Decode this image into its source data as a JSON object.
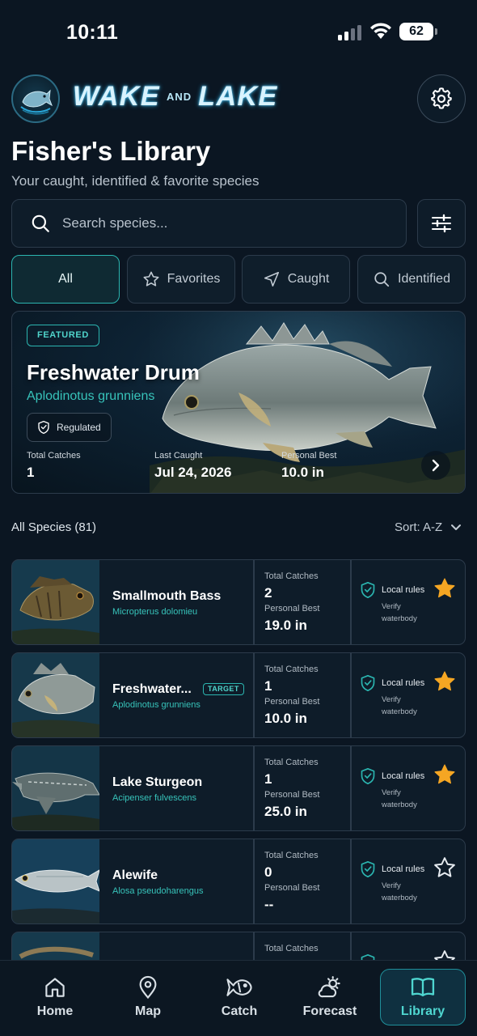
{
  "status_bar": {
    "time": "10:11",
    "battery": "62"
  },
  "brand": {
    "word_left": "WAKE",
    "word_mid": "AND",
    "word_right": "LAKE"
  },
  "header": {
    "title": "Fisher's Library",
    "subtitle": "Your caught, identified & favorite species"
  },
  "search": {
    "placeholder": "Search species..."
  },
  "filters": [
    {
      "label": "All",
      "active": true
    },
    {
      "label": "Favorites"
    },
    {
      "label": "Caught"
    },
    {
      "label": "Identified"
    }
  ],
  "featured": {
    "badge": "FEATURED",
    "name": "Freshwater Drum",
    "scientific": "Aplodinotus grunniens",
    "status": "Regulated",
    "stats": [
      {
        "label": "Total Catches",
        "value": "1"
      },
      {
        "label": "Last Caught",
        "value": "Jul 24, 2026"
      },
      {
        "label": "Personal Best",
        "value": "10.0 in"
      }
    ]
  },
  "list": {
    "heading": "All Species (81)",
    "sort_label": "Sort: A-Z"
  },
  "species": [
    {
      "name": "Smallmouth Bass",
      "scientific": "Micropterus dolomieu",
      "tag": "",
      "catches_label": "Total Catches",
      "catches": "2",
      "best_label": "Personal Best",
      "best": "19.0 in",
      "rule": "Local rules",
      "verify": "Verify waterbody",
      "favorite": true
    },
    {
      "name": "Freshwater...",
      "scientific": "Aplodinotus grunniens",
      "tag": "TARGET",
      "catches_label": "Total Catches",
      "catches": "1",
      "best_label": "Personal Best",
      "best": "10.0 in",
      "rule": "Local rules",
      "verify": "Verify waterbody",
      "favorite": true
    },
    {
      "name": "Lake Sturgeon",
      "scientific": "Acipenser fulvescens",
      "tag": "",
      "catches_label": "Total Catches",
      "catches": "1",
      "best_label": "Personal Best",
      "best": "25.0 in",
      "rule": "Local rules",
      "verify": "Verify waterbody",
      "favorite": true
    },
    {
      "name": "Alewife",
      "scientific": "Alosa pseudoharengus",
      "tag": "",
      "catches_label": "Total Catches",
      "catches": "0",
      "best_label": "Personal Best",
      "best": "--",
      "rule": "Local rules",
      "verify": "Verify waterbody",
      "favorite": false
    },
    {
      "name": "",
      "scientific": "",
      "tag": "",
      "catches_label": "Total Catches",
      "catches": "",
      "best_label": "",
      "best": "",
      "rule": "",
      "verify": "",
      "favorite": false
    }
  ],
  "tabs": [
    {
      "label": "Home",
      "icon": "home-icon"
    },
    {
      "label": "Map",
      "icon": "map-pin-icon"
    },
    {
      "label": "Catch",
      "icon": "fish-icon"
    },
    {
      "label": "Forecast",
      "icon": "weather-icon"
    },
    {
      "label": "Library",
      "icon": "book-icon",
      "active": true
    }
  ],
  "colors": {
    "background": "#0b1622",
    "accent": "#2bb5b0",
    "star": "#f5a623",
    "card": "#0e1c29"
  }
}
